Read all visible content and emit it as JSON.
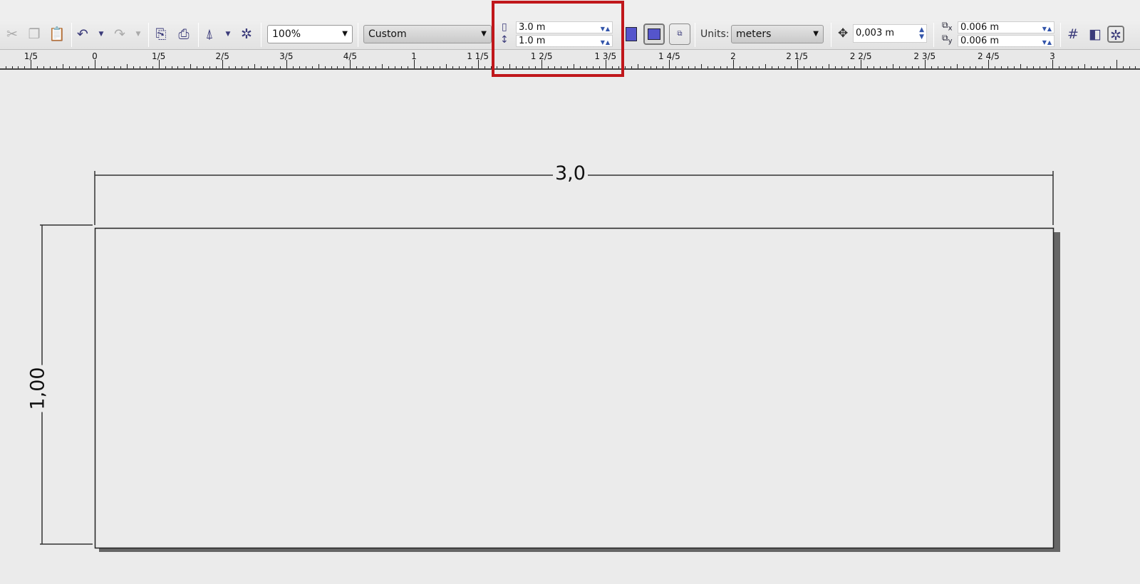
{
  "toolbar": {
    "zoom": "100%",
    "page_size": "Custom",
    "width_value": "3.0 m",
    "height_value": "1.0 m",
    "units_label": "Units:",
    "units_value": "meters",
    "nudge_value": "0,003 m",
    "dup_x_value": "0.006 m",
    "dup_y_value": "0.006 m",
    "dup_x_sub": "x",
    "dup_y_sub": "y"
  },
  "ruler": {
    "labels": [
      "1/5",
      "0",
      "1/5",
      "2/5",
      "3/5",
      "4/5",
      "1",
      "1 1/5",
      "1 2/5",
      "1 3/5",
      "1 4/5",
      "2",
      "2 1/5",
      "2 2/5",
      "2 3/5",
      "2 4/5",
      "3"
    ]
  },
  "drawing": {
    "width_dimension": "3,0",
    "height_dimension": "1,00"
  },
  "colors": {
    "highlight": "#c0171b",
    "accent_icon": "#3b3b7a"
  }
}
